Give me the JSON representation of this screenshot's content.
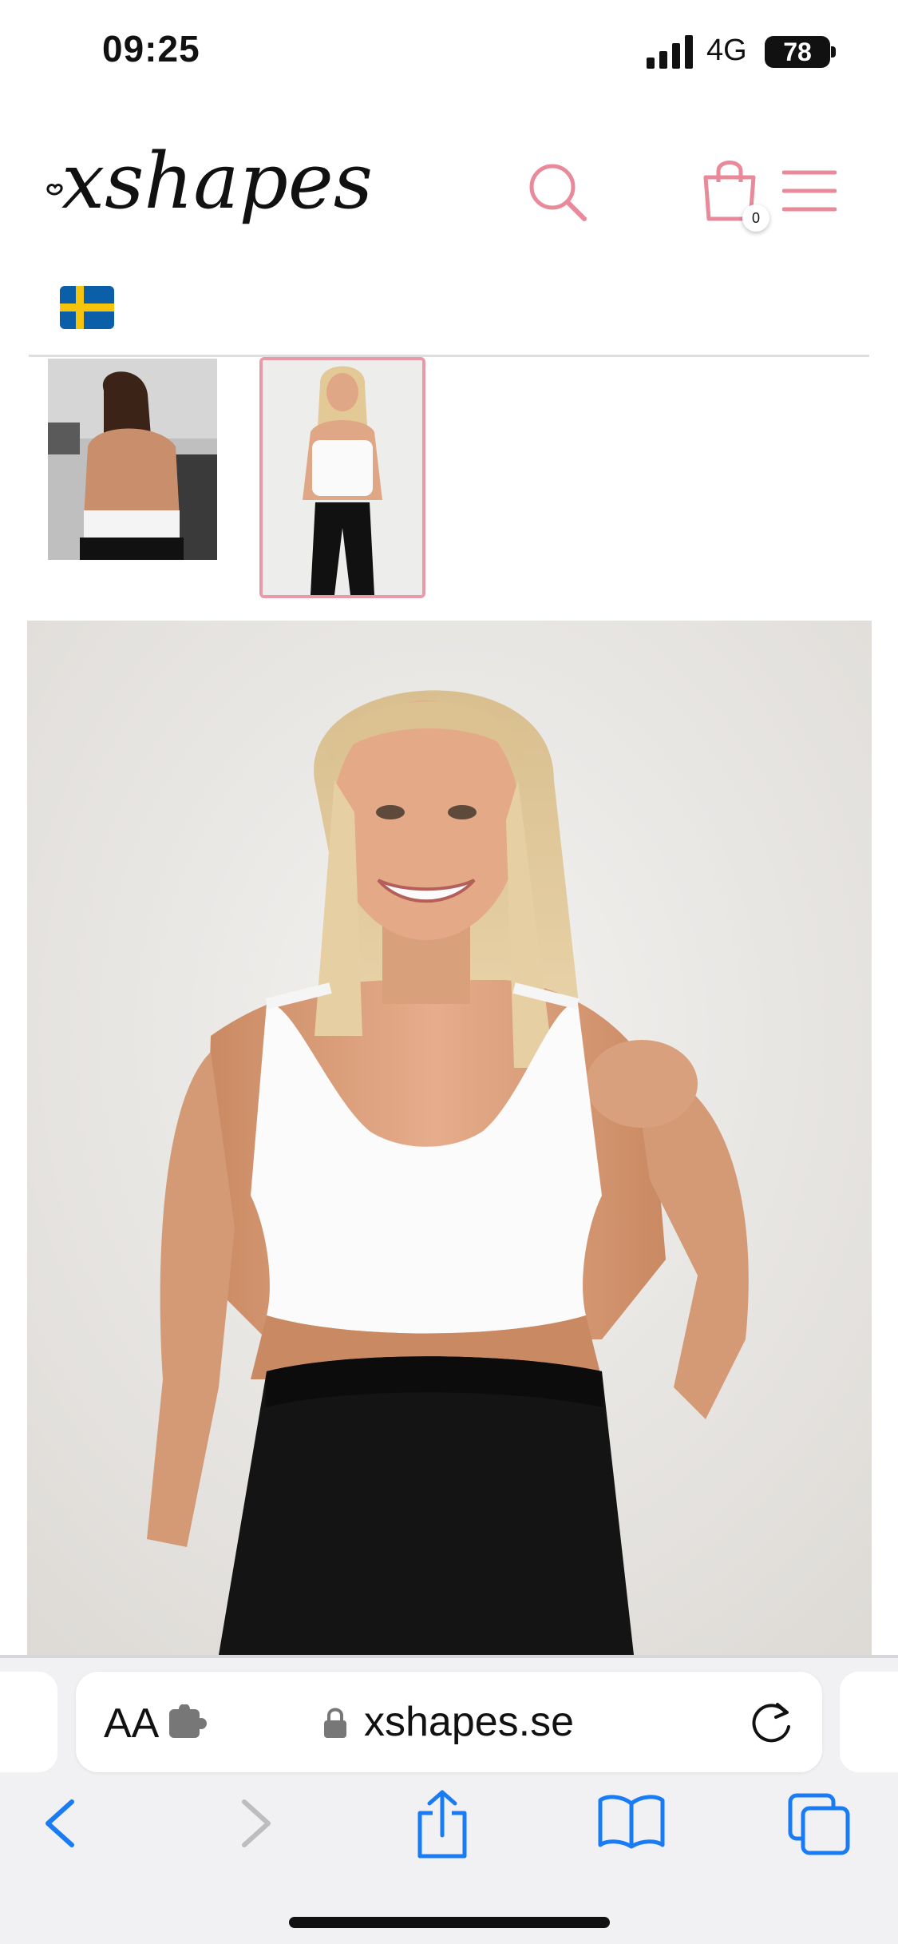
{
  "status_bar": {
    "time": "09:25",
    "network": "4G",
    "battery": "78"
  },
  "header": {
    "logo_text": "xshapes",
    "cart_count": "0",
    "brand_color": "#e88a9a",
    "country_flag": "sweden-flag-icon"
  },
  "gallery": {
    "thumbnails": [
      {
        "name": "product-thumbnail-back-view",
        "selected": false
      },
      {
        "name": "product-thumbnail-front-view",
        "selected": true
      }
    ],
    "main_image": "product-main-image"
  },
  "browser": {
    "text_size_label": "AA",
    "url": "xshapes.se",
    "accent_color": "#1a7cf5"
  }
}
